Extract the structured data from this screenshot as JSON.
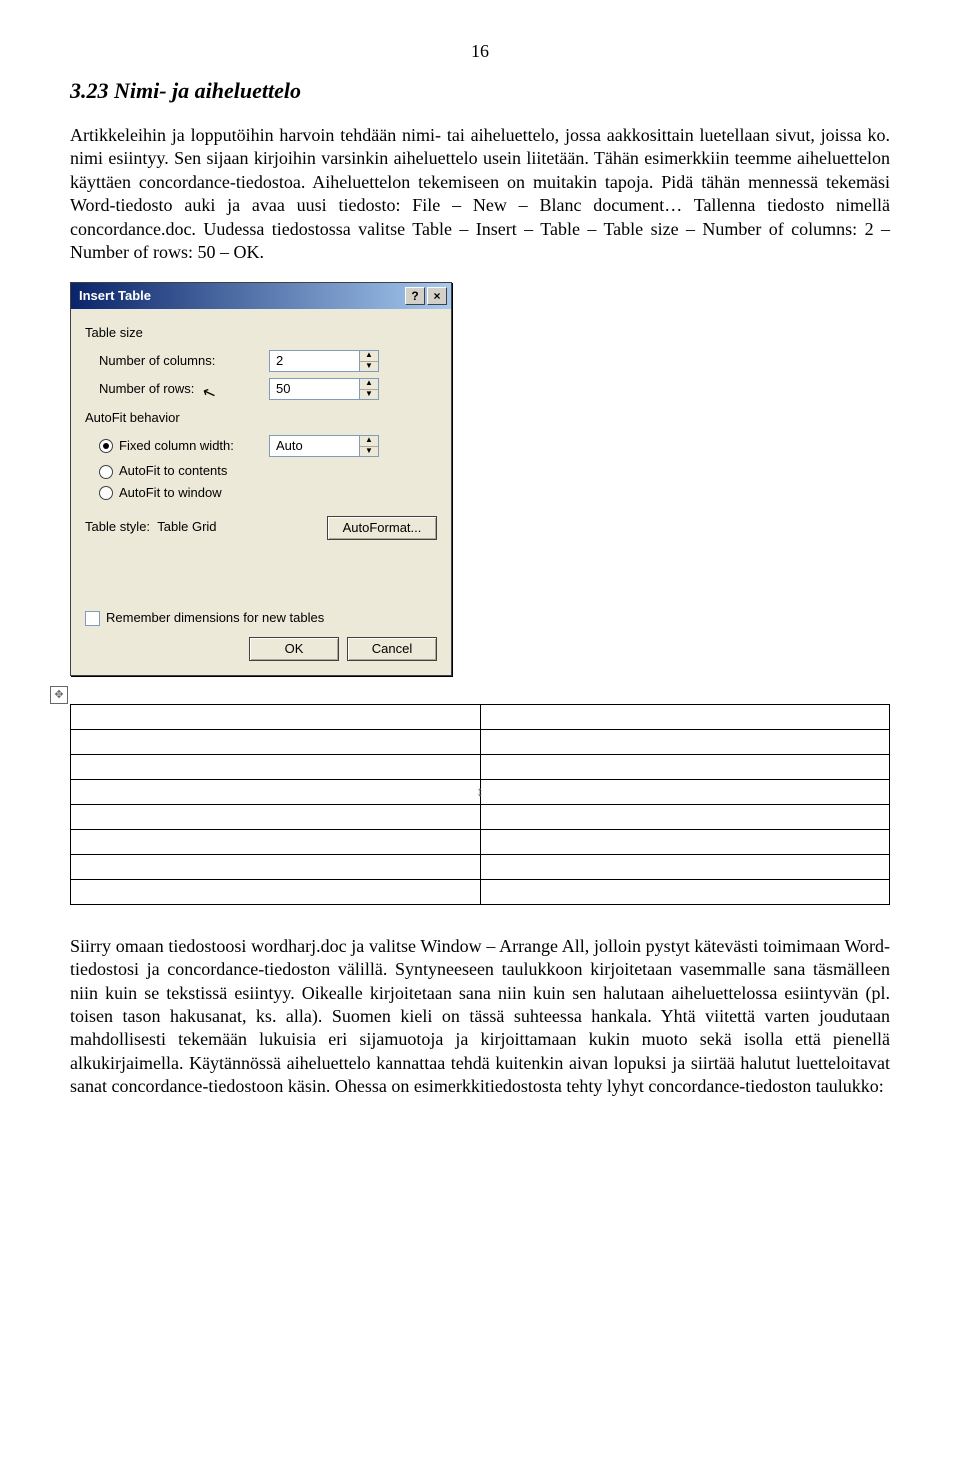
{
  "page_number": "16",
  "heading": "3.23 Nimi- ja aiheluettelo",
  "paragraph1": "Artikkeleihin ja lopputöihin harvoin tehdään nimi- tai aiheluettelo, jossa aakkosittain luetellaan sivut, joissa ko. nimi esiintyy. Sen sijaan kirjoihin varsinkin aiheluettelo usein liitetään. Tähän esimerkkiin teemme aiheluettelon käyttäen concordance-tiedostoa. Aiheluettelon tekemiseen on muitakin tapoja. Pidä tähän mennessä tekemäsi Word-tiedosto auki ja avaa uusi tiedosto: File – New – Blanc document… Tallenna tiedosto nimellä concordance.doc. Uudessa tiedostossa valitse Table – Insert – Table – Table size – Number of columns: 2 – Number of rows: 50 – OK.",
  "dialog": {
    "title": "Insert Table",
    "group_tablesize": "Table size",
    "label_cols": "Number of columns:",
    "value_cols": "2",
    "label_rows": "Number of rows:",
    "value_rows": "50",
    "group_autofit": "AutoFit behavior",
    "radio_fixed": "Fixed column width:",
    "value_fixed": "Auto",
    "radio_contents": "AutoFit to contents",
    "radio_window": "AutoFit to window",
    "style_label": "Table style:",
    "style_value": "Table Grid",
    "autoformat_btn": "AutoFormat...",
    "remember": "Remember dimensions for new tables",
    "ok": "OK",
    "cancel": "Cancel"
  },
  "paragraph2": "Siirry omaan tiedostoosi wordharj.doc ja valitse Window – Arrange All, jolloin pystyt kätevästi toimimaan Word-tiedostosi ja concordance-tiedoston välillä. Syntyneeseen taulukkoon kirjoitetaan vasemmalle sana täsmälleen niin kuin se tekstissä esiintyy. Oikealle kirjoitetaan sana niin kuin sen halutaan aiheluettelossa esiintyvän (pl. toisen tason hakusanat, ks. alla). Suomen kieli on tässä suhteessa hankala. Yhtä viitettä varten joudutaan mahdollisesti tekemään lukuisia eri sijamuotoja ja kirjoittamaan kukin muoto sekä isolla että pienellä alkukirjaimella. Käytännössä aiheluettelo kannattaa tehdä kuitenkin aivan lopuksi ja siirtää halutut luetteloitavat sanat concordance-tiedostoon käsin. Ohessa on esimerkkitiedostosta tehty lyhyt concordance-tiedoston taulukko:"
}
